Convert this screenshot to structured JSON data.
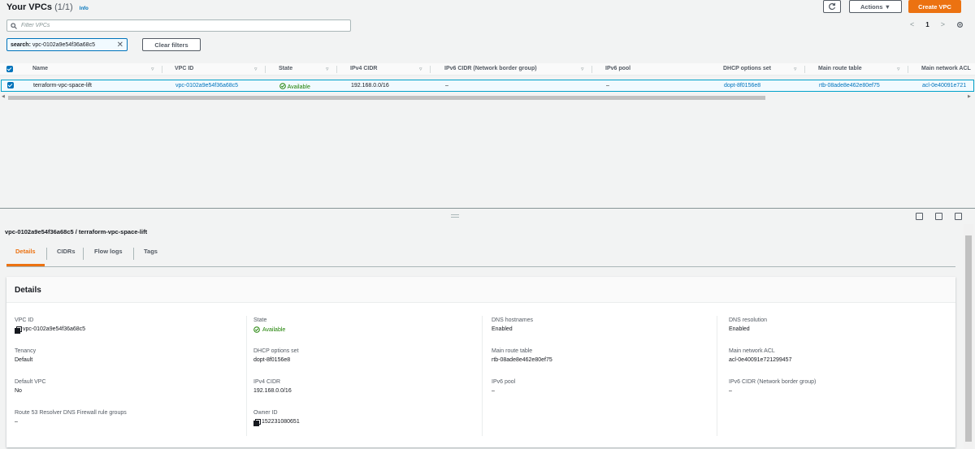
{
  "header": {
    "title": "Your VPCs",
    "count": "(1/1)",
    "info": "Info",
    "refresh_icon": "refresh-icon",
    "actions_label": "Actions ▼",
    "create_label": "Create VPC"
  },
  "filter": {
    "placeholder": "Filter VPCs",
    "token_prefix": "search:",
    "token_value": "vpc-0102a9e54f36a68c5",
    "clear_label": "Clear filters"
  },
  "pagination": {
    "prev": "<",
    "page": "1",
    "next": ">"
  },
  "table": {
    "columns": [
      "Name",
      "VPC ID",
      "State",
      "IPv4 CIDR",
      "IPv6 CIDR (Network border group)",
      "IPv6 pool",
      "DHCP options set",
      "Main route table",
      "Main network ACL"
    ],
    "row": {
      "name": "terraform-vpc-space-lift",
      "vpc_id": "vpc-0102a9e54f36a68c5",
      "state": "Available",
      "ipv4": "192.168.0.0/16",
      "ipv6": "–",
      "ipv6_pool": "–",
      "dhcp": "dopt-8f0156e8",
      "route_table": "rtb-08ade8e462e80ef75",
      "acl": "acl-0e40091e721"
    }
  },
  "detail": {
    "title": "vpc-0102a9e54f36a68c5 / terraform-vpc-space-lift",
    "tabs": [
      "Details",
      "CIDRs",
      "Flow logs",
      "Tags"
    ],
    "card_title": "Details",
    "col1": [
      {
        "label": "VPC ID",
        "value": "vpc-0102a9e54f36a68c5"
      },
      {
        "label": "Tenancy",
        "value": "Default"
      },
      {
        "label": "Default VPC",
        "value": "No"
      },
      {
        "label": "Route 53 Resolver DNS Firewall rule groups",
        "value": "–"
      }
    ],
    "col2": [
      {
        "label": "State",
        "value": "Available"
      },
      {
        "label": "DHCP options set",
        "value": "dopt-8f0156e8"
      },
      {
        "label": "IPv4 CIDR",
        "value": "192.168.0.0/16"
      },
      {
        "label": "Owner ID",
        "value": "152231080651"
      }
    ],
    "col3": [
      {
        "label": "DNS hostnames",
        "value": "Enabled"
      },
      {
        "label": "Main route table",
        "value": "rtb-08ade8e462e80ef75"
      },
      {
        "label": "IPv6 pool",
        "value": "–"
      }
    ],
    "col4": [
      {
        "label": "DNS resolution",
        "value": "Enabled"
      },
      {
        "label": "Main network ACL",
        "value": "acl-0e40091e721299457"
      },
      {
        "label": "IPv6 CIDR (Network border group)",
        "value": "–"
      }
    ]
  },
  "colors": {
    "accent": "#ec7211",
    "link": "#0073bb",
    "success": "#1d8102"
  }
}
